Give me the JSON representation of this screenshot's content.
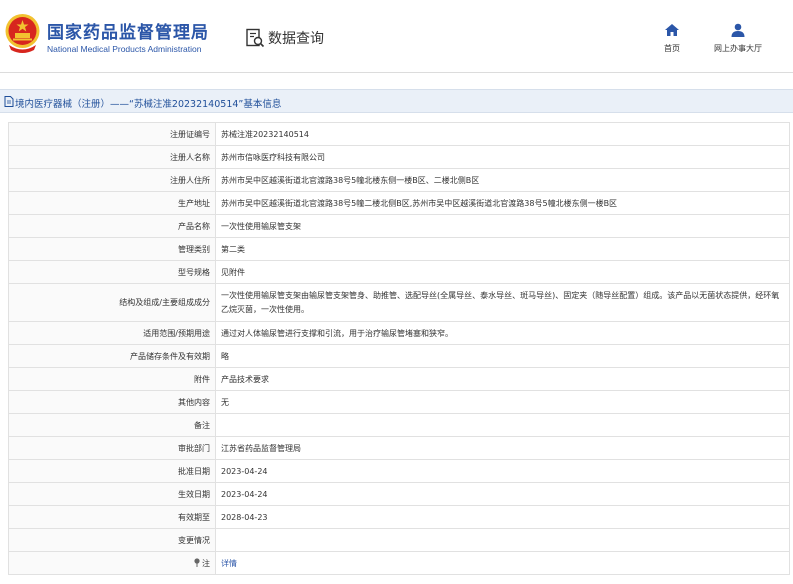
{
  "header": {
    "org_cn": "国家药品监督管理局",
    "org_en": "National Medical Products Administration",
    "query_label": "数据查询",
    "nav": {
      "home": "首页",
      "hall": "网上办事大厅"
    }
  },
  "title": "境内医疗器械（注册）——“苏械注准20232140514”基本信息",
  "colors": {
    "brand_blue": "#2b56a8",
    "logo_red": "#d7261e",
    "logo_gold": "#f2c230"
  },
  "rows": [
    {
      "label": "注册证编号",
      "value": "苏械注准20232140514"
    },
    {
      "label": "注册人名称",
      "value": "苏州市信咏医疗科技有限公司"
    },
    {
      "label": "注册人住所",
      "value": "苏州市吴中区越溪街道北官渡路38号5幢北楼东侧一楼B区、二楼北侧B区"
    },
    {
      "label": "生产地址",
      "value": "苏州市吴中区越溪街道北官渡路38号5幢二楼北侧B区,苏州市吴中区越溪街道北官渡路38号5幢北楼东侧一楼B区"
    },
    {
      "label": "产品名称",
      "value": "一次性使用输尿管支架"
    },
    {
      "label": "管理类别",
      "value": "第二类"
    },
    {
      "label": "型号规格",
      "value": "见附件"
    },
    {
      "label": "结构及组成/主要组成成分",
      "value": "一次性使用输尿管支架由输尿管支架管身、助推管、选配导丝(全属导丝、泰水导丝、斑马导丝)、固定夹（随导丝配置）组成。该产品以无菌状态提供，经环氧乙烷灭菌，一次性使用。"
    },
    {
      "label": "适用范围/预期用途",
      "value": "通过对人体输尿管进行支撑和引流，用于治疗输尿管堵塞和狭窄。"
    },
    {
      "label": "产品储存条件及有效期",
      "value": "略"
    },
    {
      "label": "附件",
      "value": "产品技术要求"
    },
    {
      "label": "其他内容",
      "value": "无"
    },
    {
      "label": "备注",
      "value": ""
    },
    {
      "label": "审批部门",
      "value": "江苏省药品监督管理局"
    },
    {
      "label": "批准日期",
      "value": "2023-04-24"
    },
    {
      "label": "生效日期",
      "value": "2023-04-24"
    },
    {
      "label": "有效期至",
      "value": "2028-04-23"
    },
    {
      "label": "变更情况",
      "value": ""
    },
    {
      "label": "注",
      "value": "详情"
    }
  ]
}
